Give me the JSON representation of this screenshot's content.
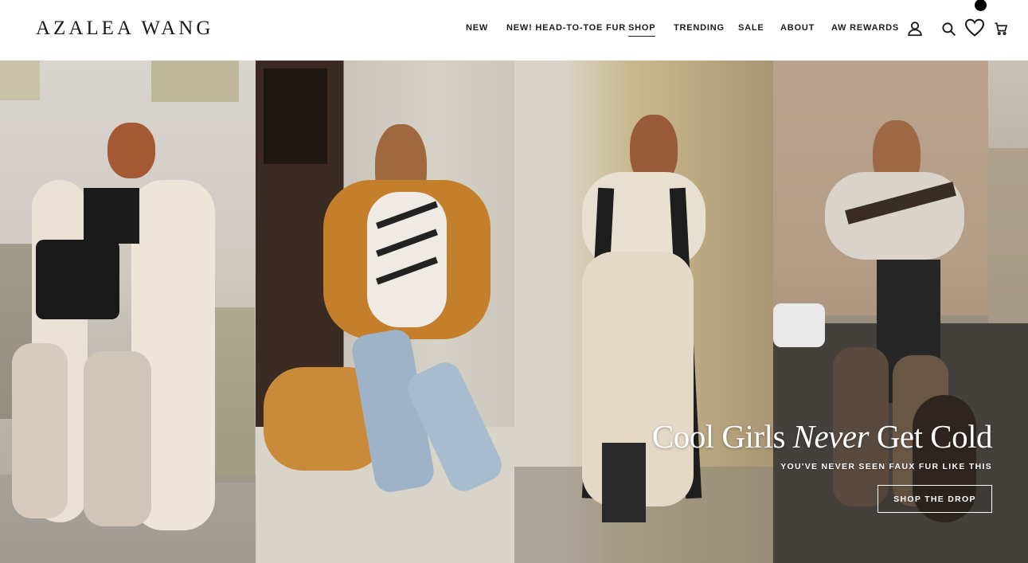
{
  "brand": {
    "logo_text": "AZALEA WANG"
  },
  "nav": {
    "items": [
      {
        "label": "NEW"
      },
      {
        "label": "NEW! HEAD-TO-TOE FUR"
      },
      {
        "label": "SHOP",
        "active": true
      },
      {
        "label": "TRENDING"
      },
      {
        "label": "SALE"
      },
      {
        "label": "ABOUT"
      },
      {
        "label": "AW REWARDS"
      }
    ]
  },
  "header_icons": [
    "account-icon",
    "search-icon",
    "heart-icon",
    "cart-icon"
  ],
  "hero": {
    "headline_part1": "Cool Girls ",
    "headline_italic": "Never",
    "headline_part2": " Get Cold",
    "subheadline": "YOU'VE NEVER SEEN FAUX FUR LIKE THIS",
    "cta_label": "SHOP THE DROP"
  },
  "colors": {
    "text": "#1a1a1a",
    "background": "#ffffff",
    "hero_text": "#ffffff"
  }
}
